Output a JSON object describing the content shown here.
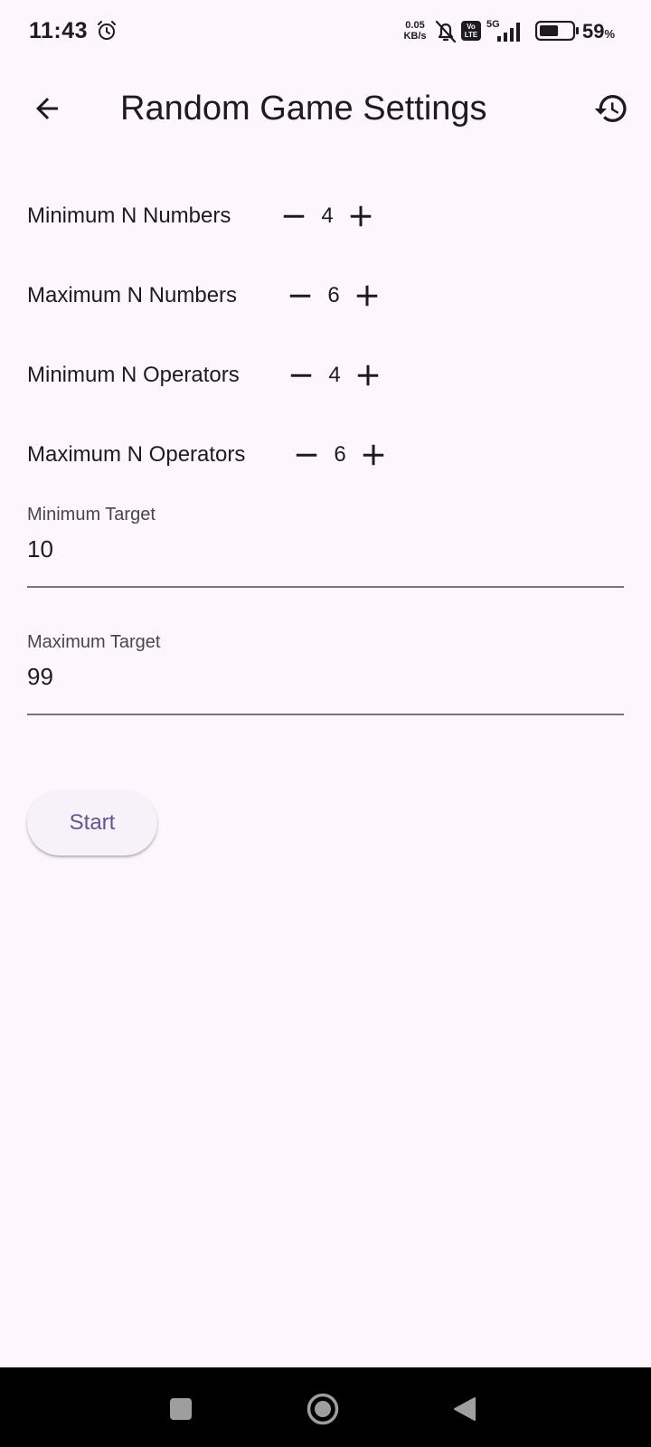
{
  "status_bar": {
    "time": "11:43",
    "net_speed_value": "0.05",
    "net_speed_unit": "KB/s",
    "volte_line1": "Vo",
    "volte_line2": "LTE",
    "network": "5G",
    "battery_percent": "59",
    "battery_percent_sign": "%",
    "battery_level": 0.59,
    "icons": [
      "alarm-icon",
      "notifications-off-icon",
      "volte-icon",
      "signal-icon",
      "battery-icon"
    ]
  },
  "app_bar": {
    "title": "Random Game Settings",
    "back_icon": "arrow-back-icon",
    "history_icon": "history-icon"
  },
  "steppers": [
    {
      "label": "Minimum N Numbers",
      "value": "4"
    },
    {
      "label": "Maximum N Numbers",
      "value": "6"
    },
    {
      "label": "Minimum N Operators",
      "value": "4"
    },
    {
      "label": "Maximum N Operators",
      "value": "6"
    }
  ],
  "fields": [
    {
      "label": "Minimum Target",
      "value": "10"
    },
    {
      "label": "Maximum Target",
      "value": "99"
    }
  ],
  "start_label": "Start",
  "nav_bar": {
    "icons": [
      "recents-square-icon",
      "home-circle-icon",
      "back-triangle-icon"
    ]
  },
  "colors": {
    "background": "#fdf7fd",
    "text": "#1d1b20",
    "accent": "#65558f",
    "field_underline": "#79747e",
    "nav_bar": "#000000"
  }
}
